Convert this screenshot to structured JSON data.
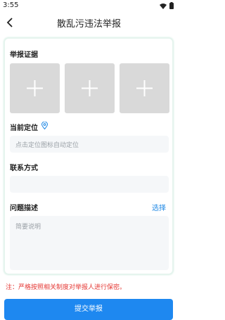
{
  "status_bar": {
    "time": "3:55"
  },
  "nav": {
    "title": "散乱污违法举报"
  },
  "form": {
    "evidence_label": "举报证据",
    "location_label": "当前定位",
    "location_placeholder": "点击定位图标自动定位",
    "contact_label": "联系方式",
    "contact_value": "",
    "description_label": "问题描述",
    "choose_label": "选择",
    "description_placeholder": "简要说明"
  },
  "notice": "注：严格按照相关制度对举报人进行保密。",
  "submit_label": "提交举报",
  "colors": {
    "accent": "#1e88f0",
    "warning": "#e53935",
    "placeholder": "#9aa0a6"
  },
  "icons": [
    "back-icon",
    "wifi-icon",
    "battery-icon",
    "plus-icon",
    "location-pin-icon"
  ]
}
